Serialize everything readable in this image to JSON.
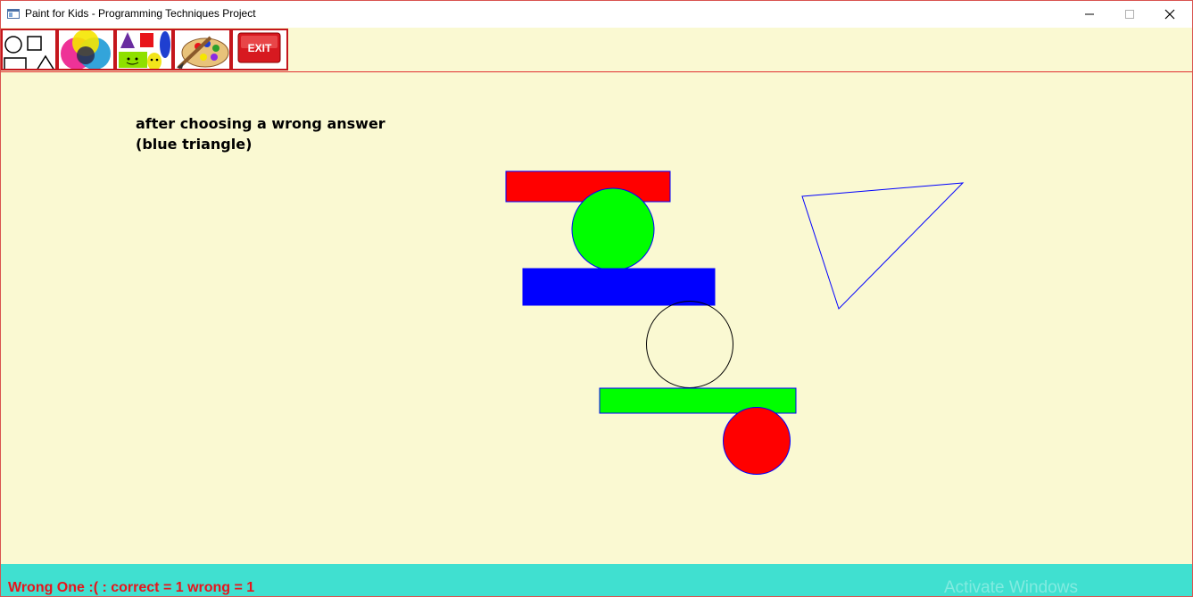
{
  "window": {
    "title": "Paint for Kids - Programming Techniques Project"
  },
  "toolbar": {
    "items": [
      {
        "name": "shapes-tool",
        "icon": "shapes-icon"
      },
      {
        "name": "colors-tool",
        "icon": "color-circles-icon"
      },
      {
        "name": "shapes-colors-tool",
        "icon": "colored-shapes-faces-icon"
      },
      {
        "name": "paint-palette-tool",
        "icon": "palette-brush-icon"
      },
      {
        "name": "exit-tool",
        "icon": "exit-icon",
        "label": "EXIT"
      }
    ]
  },
  "canvas": {
    "note_line1": "after choosing a wrong answer",
    "note_line2": "(blue triangle)",
    "shapes": [
      {
        "type": "rectangle",
        "fill": "#ff0000",
        "stroke": "#0000ff"
      },
      {
        "type": "circle",
        "fill": "#00ff00",
        "stroke": "#0000ff"
      },
      {
        "type": "rectangle",
        "fill": "#0000ff",
        "stroke": "#0000ff"
      },
      {
        "type": "circle",
        "fill": "none",
        "stroke": "#000000"
      },
      {
        "type": "rectangle",
        "fill": "#00ff00",
        "stroke": "#0000ff"
      },
      {
        "type": "circle",
        "fill": "#ff0000",
        "stroke": "#0000ff"
      },
      {
        "type": "triangle",
        "fill": "none",
        "stroke": "#0000ff"
      }
    ]
  },
  "status": {
    "message": "Wrong One :( : correct = 1 wrong = 1",
    "watermark": "Activate Windows"
  },
  "colors": {
    "background": "#faf9d2",
    "status_bar": "#40e0d0",
    "status_text": "#e8141b",
    "toolbar_border": "#c4161c"
  }
}
